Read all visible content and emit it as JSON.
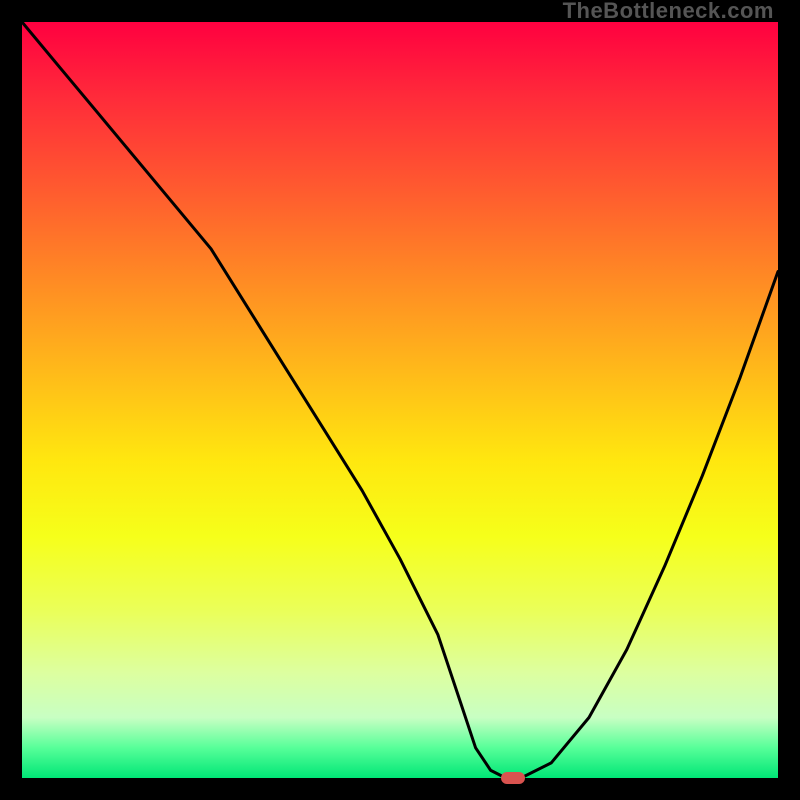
{
  "attribution": "TheBottleneck.com",
  "colors": {
    "frame": "#000000",
    "gradient_top": "#ff0040",
    "gradient_bottom": "#00e676",
    "curve": "#000000",
    "marker": "#d9534f"
  },
  "chart_data": {
    "type": "line",
    "title": "",
    "xlabel": "",
    "ylabel": "",
    "xlim": [
      0,
      100
    ],
    "ylim": [
      0,
      100
    ],
    "grid": false,
    "legend": false,
    "x": [
      0,
      5,
      10,
      15,
      20,
      25,
      30,
      35,
      40,
      45,
      50,
      55,
      58,
      60,
      62,
      64,
      66,
      70,
      75,
      80,
      85,
      90,
      95,
      100
    ],
    "values": [
      100,
      94,
      88,
      82,
      76,
      70,
      62,
      54,
      46,
      38,
      29,
      19,
      10,
      4,
      1,
      0,
      0,
      2,
      8,
      17,
      28,
      40,
      53,
      67
    ],
    "annotations": [
      {
        "name": "optimal-marker",
        "x": 65,
        "y": 0
      }
    ]
  }
}
